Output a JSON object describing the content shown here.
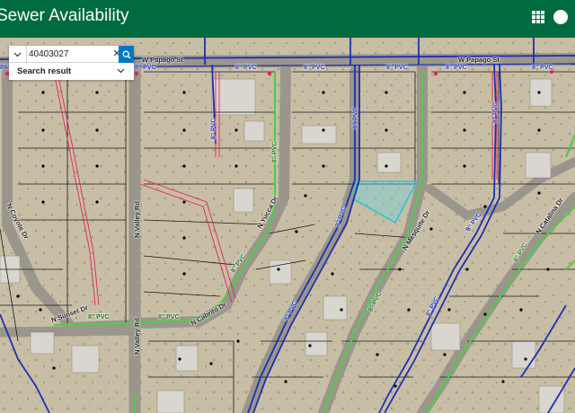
{
  "header": {
    "title": "Sewer Availability",
    "brand_color": "#006b3f"
  },
  "search": {
    "value": "40403027",
    "result_label": "Search result",
    "button_icon": "search-icon",
    "clear_icon": "close-icon",
    "source_icon": "chevron-down-icon",
    "result_icon": "chevron-down-icon"
  },
  "map": {
    "road_labels": {
      "w_papago_west": "W Papago St",
      "w_papago_east": "W Papago St",
      "n_valley_rd": "N Valley Rd",
      "n_valley_rd_south": "N Valley Rd",
      "n_yucca_dr": "N Yucca Dr",
      "n_cabrito_dr": "N Cabrito Dr",
      "n_mesquite_dr": "N Mesquite Dr",
      "n_catalina_dr": "N Catalina Dr",
      "n_coyote_dr": "N Coyote Dr",
      "n_sunset_dr": "N Sunset Dr"
    },
    "pipe_labels": {
      "p1": "8\" PVC",
      "p2": "8\" PVC",
      "p3": "8\" PVC",
      "p4": "8\" PVC",
      "p5": "8\" PVC",
      "p6": "8\" PVC",
      "p7": "8\" PVC",
      "p8": "8\" PVC",
      "p9": "8\" PVC",
      "p10": "8\" PVC",
      "p11": "8\" PVC",
      "p12": "8\" PVC",
      "p13": "8\" PVC",
      "p14": "8\" PVC",
      "p15": "8\" PVC",
      "p16": "8\" PVC",
      "p17": "8\" PVC",
      "p18": "8\" PVC",
      "p19": "8\" PVC",
      "p20": "8\" PVC"
    },
    "colors": {
      "sewer_main": "#1f2fb0",
      "sewer_lateral_red": "#e0245e",
      "pvc_line": "#57c84d",
      "parcel_line": "#1a1a1a",
      "selected_parcel": "#5bd6e8"
    }
  }
}
